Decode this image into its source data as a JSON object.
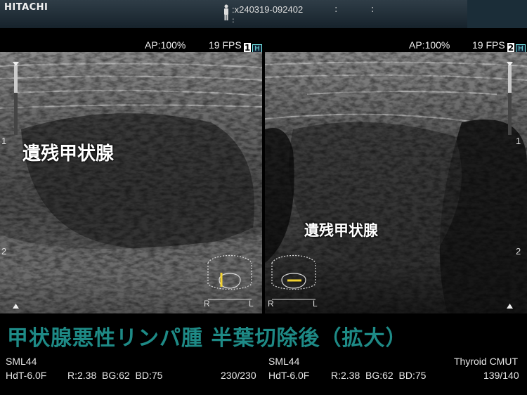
{
  "header": {
    "brand": "HITACHI",
    "patient_id": ":x240319-092402",
    "colon_a": ":",
    "colon_b": ":",
    "colon_c": ":"
  },
  "left_image": {
    "ap_label": "AP:100%",
    "fps_label": "19 FPS",
    "panel_number": "1",
    "h_label": "H",
    "annotation": "遺残甲状腺",
    "depth_ticks": [
      "1",
      "2"
    ],
    "probe_marker": {
      "r": "R",
      "l": "L"
    },
    "probe_orientation": "longitudinal"
  },
  "right_image": {
    "ap_label": "AP:100%",
    "fps_label": "19 FPS",
    "panel_number": "2",
    "h_label": "H",
    "annotation": "遺残甲状腺",
    "depth_ticks": [
      "1",
      "2"
    ],
    "probe_marker": {
      "r": "R",
      "l": "L"
    },
    "probe_orientation": "transverse"
  },
  "caption": "甲状腺悪性リンパ腫 半葉切除後（拡大）",
  "footer_left": {
    "probe": "SML44",
    "mode": "HdT-6.0F",
    "params": "R:2.38  BG:62  BD:75",
    "frames": "230/230"
  },
  "footer_right": {
    "probe": "SML44",
    "mode": "HdT-6.0F",
    "params": "R:2.38  BG:62  BD:75",
    "preset": "Thyroid CMUT",
    "frames": "139/140"
  },
  "colors": {
    "caption": "#1e8a86",
    "probe_marker": "#f2d230",
    "header_bg": "#22303a"
  }
}
